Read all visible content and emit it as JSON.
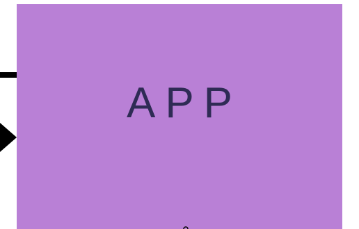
{
  "app": {
    "label": "APP"
  },
  "colors": {
    "app_background": "#b980d6",
    "app_label": "#2f2b55",
    "connector": "#000000",
    "page_background": "#ffffff"
  }
}
